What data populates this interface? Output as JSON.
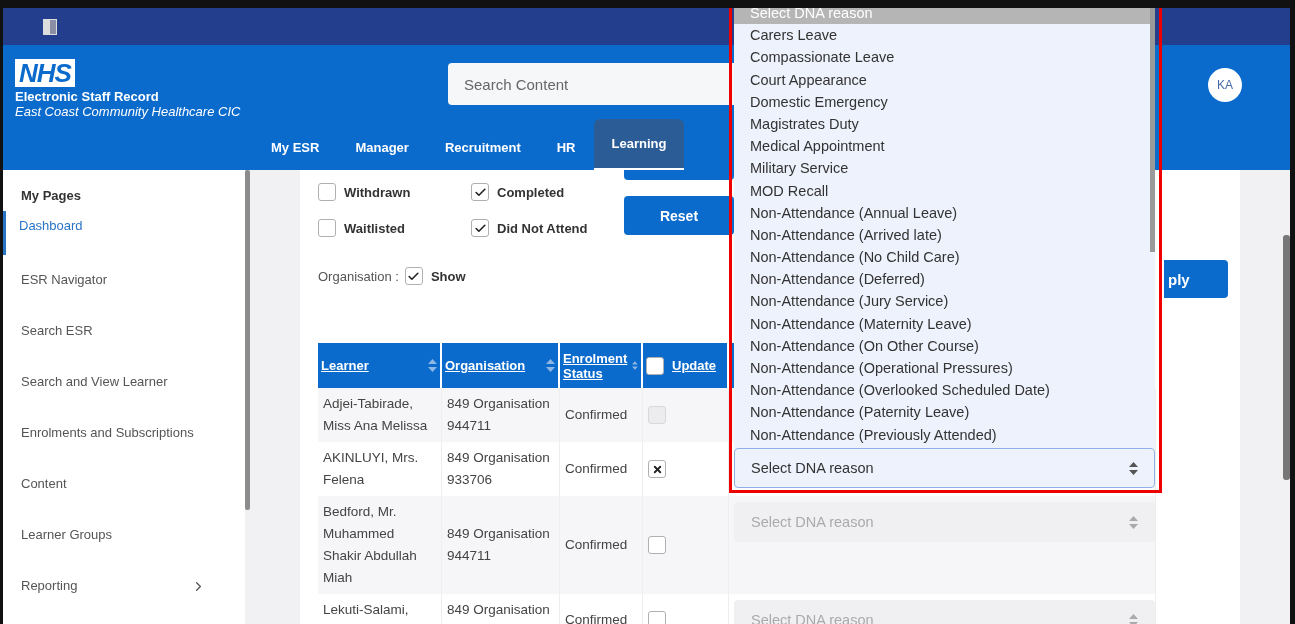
{
  "header": {
    "brand": {
      "logo": "NHS",
      "title": "Electronic Staff Record",
      "subtitle": "East Coast Community Healthcare CIC"
    },
    "search": {
      "placeholder": "Search Content"
    },
    "avatar": "KA"
  },
  "nav": [
    {
      "label": "My ESR",
      "selected": false
    },
    {
      "label": "Manager",
      "selected": false
    },
    {
      "label": "Recruitment",
      "selected": false
    },
    {
      "label": "HR",
      "selected": false
    },
    {
      "label": "Learning",
      "selected": true
    }
  ],
  "sidebar": {
    "heading": "My Pages",
    "items": [
      {
        "label": "Dashboard",
        "selected": true
      },
      {
        "label": "ESR Navigator",
        "selected": false
      },
      {
        "label": "Search ESR",
        "selected": false
      },
      {
        "label": "Search and View Learner",
        "selected": false
      },
      {
        "label": "Enrolments and Subscriptions",
        "selected": false
      },
      {
        "label": "Content",
        "selected": false
      },
      {
        "label": "Learner Groups",
        "selected": false
      },
      {
        "label": "Reporting",
        "selected": false,
        "has_submenu": true
      }
    ]
  },
  "filters": [
    {
      "label": "Withdrawn",
      "checked": false
    },
    {
      "label": "Completed",
      "checked": true
    },
    {
      "label": "Waitlisted",
      "checked": false
    },
    {
      "label": "Did Not Attend",
      "checked": true
    }
  ],
  "reset_button": "Reset",
  "apply_button": "ply",
  "organisation": {
    "label": "Organisation :",
    "checked": true,
    "option": "Show"
  },
  "table": {
    "columns": [
      {
        "label": "Learner",
        "kind": "sort"
      },
      {
        "label": "Organisation",
        "kind": "sort"
      },
      {
        "label": "Enrolment Status",
        "kind": "sort"
      },
      {
        "label": "Update",
        "kind": "checkbox",
        "checked": false
      }
    ],
    "rows": [
      {
        "learner": "Adjei-Tabirade, Miss Ana Melissa",
        "organisation": "849 Organisation 944711",
        "status": "Confirmed",
        "update": {
          "checked": false,
          "disabled": true
        }
      },
      {
        "learner": "AKINLUYI, Mrs. Felena",
        "organisation": "849 Organisation 933706",
        "status": "Confirmed",
        "update": {
          "checked": true,
          "disabled": false
        },
        "dna": {
          "placeholder": "Select DNA reason",
          "disabled": false,
          "open": true
        }
      },
      {
        "learner": "Bedford, Mr. Muhammed Shakir Abdullah Miah",
        "organisation": "849 Organisation 944711",
        "status": "Confirmed",
        "update": {
          "checked": false,
          "disabled": false
        },
        "dna": {
          "placeholder": "Select DNA reason",
          "disabled": true,
          "open": false
        }
      },
      {
        "learner": "Lekuti-Salami,",
        "organisation": "849 Organisation",
        "status": "Confirmed",
        "update": {
          "checked": false,
          "disabled": false
        },
        "dna": {
          "placeholder": "Select DNA reason",
          "disabled": true,
          "open": false
        }
      }
    ]
  },
  "dropdown": {
    "options": [
      {
        "label": "Select DNA reason",
        "selected": true
      },
      {
        "label": "Carers Leave",
        "selected": false
      },
      {
        "label": "Compassionate Leave",
        "selected": false
      },
      {
        "label": "Court Appearance",
        "selected": false
      },
      {
        "label": "Domestic Emergency",
        "selected": false
      },
      {
        "label": "Magistrates Duty",
        "selected": false
      },
      {
        "label": "Medical Appointment",
        "selected": false
      },
      {
        "label": "Military Service",
        "selected": false
      },
      {
        "label": "MOD Recall",
        "selected": false
      },
      {
        "label": "Non-Attendance (Annual Leave)",
        "selected": false
      },
      {
        "label": "Non-Attendance (Arrived late)",
        "selected": false
      },
      {
        "label": "Non-Attendance (No Child Care)",
        "selected": false
      },
      {
        "label": "Non-Attendance (Deferred)",
        "selected": false
      },
      {
        "label": "Non-Attendance (Jury Service)",
        "selected": false
      },
      {
        "label": "Non-Attendance (Maternity Leave)",
        "selected": false
      },
      {
        "label": "Non-Attendance (On Other Course)",
        "selected": false
      },
      {
        "label": "Non-Attendance (Operational Pressures)",
        "selected": false
      },
      {
        "label": "Non-Attendance (Overlooked Scheduled Date)",
        "selected": false
      },
      {
        "label": "Non-Attendance (Paternity Leave)",
        "selected": false
      },
      {
        "label": "Non-Attendance (Previously Attended)",
        "selected": false
      }
    ]
  }
}
